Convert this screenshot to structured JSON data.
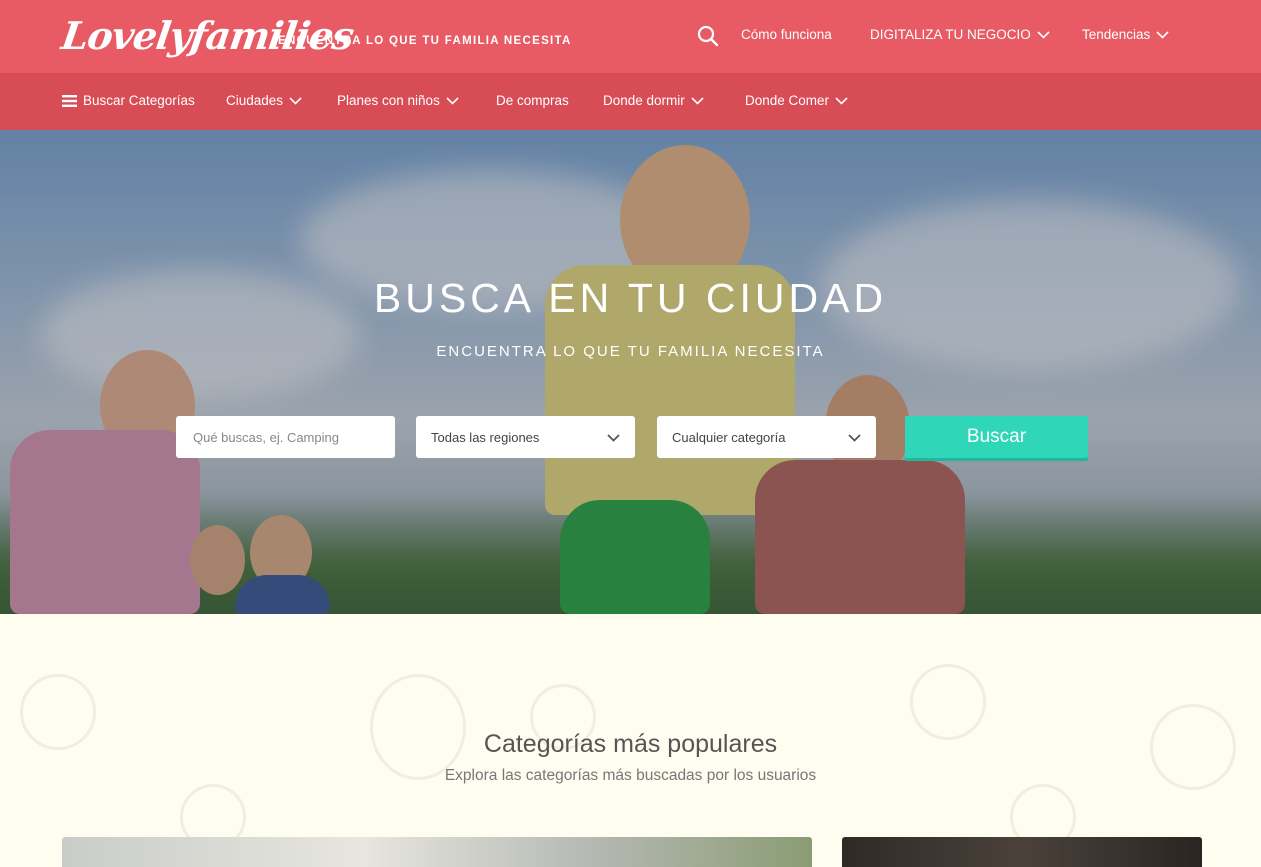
{
  "header": {
    "logo": "Lovelyfamilies",
    "tagline": "ENCUENTRA LO QUE TU FAMILIA NECESITA",
    "nav": [
      "Cómo funciona",
      "DIGITALIZA TU NEGOCIO",
      "Tendencias"
    ]
  },
  "subnav": {
    "items": [
      "Buscar Categorías",
      "Ciudades",
      "Planes con niños",
      "De compras",
      "Donde dormir",
      "Donde Comer"
    ]
  },
  "hero": {
    "title": "BUSCA EN TU CIUDAD",
    "subtitle": "ENCUENTRA LO QUE TU FAMILIA NECESITA",
    "search_placeholder": "Qué buscas, ej. Camping",
    "region_value": "Todas las regiones",
    "category_value": "Cualquier categoría",
    "button": "Buscar"
  },
  "categories": {
    "title": "Categorías más populares",
    "subtitle": "Explora las categorías más buscadas por los usuarios"
  },
  "colors": {
    "header": "#e85b65",
    "subnav": "#d84c56",
    "accent": "#2fd7b8",
    "background": "#fffdf0"
  }
}
